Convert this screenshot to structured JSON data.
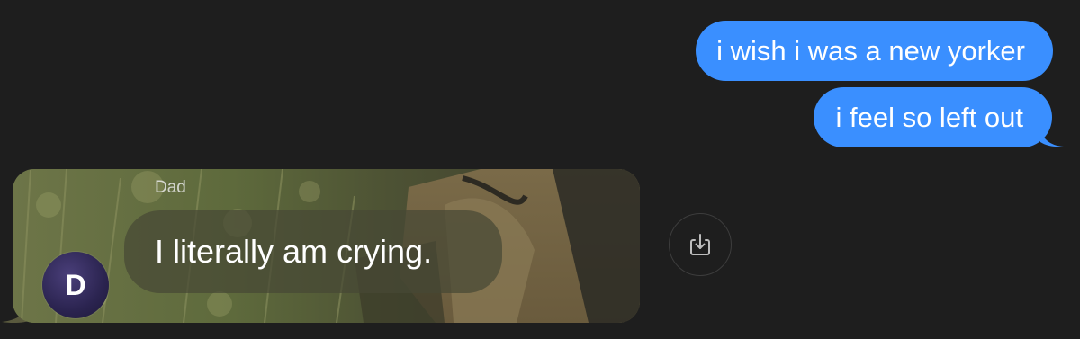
{
  "conversation": {
    "outgoing_messages": [
      {
        "text": "i wish i was a new yorker"
      },
      {
        "text": "i feel so left out"
      }
    ],
    "incoming_message": {
      "sender_name": "Dad",
      "avatar_initial": "D",
      "text": "I literally am crying."
    }
  },
  "colors": {
    "background": "#1e1e1e",
    "outgoing_bubble": "#3a8fff",
    "avatar": "#2b2450"
  },
  "icons": {
    "save": "save-download-icon"
  }
}
